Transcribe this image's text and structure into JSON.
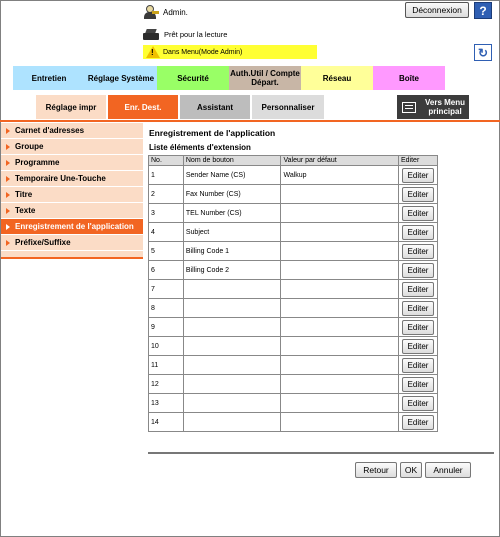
{
  "header": {
    "user_label": "Admin.",
    "logout_label": "Déconnexion",
    "help_label": "?",
    "status_text": "Prêt pour la lecture",
    "mode_text": "Dans Menu(Mode Admin)"
  },
  "main_tabs": [
    {
      "label": "Entretien",
      "color": "#aee3ff"
    },
    {
      "label": "Réglage Système",
      "color": "#aee3ff"
    },
    {
      "label": "Sécurité",
      "color": "#99ff66"
    },
    {
      "label": "Auth.Util / Compte Départ.",
      "color": "#c8b6a6"
    },
    {
      "label": "Réseau",
      "color": "#ffff99"
    },
    {
      "label": "Boîte",
      "color": "#ff99ff"
    }
  ],
  "sub_tabs": [
    {
      "label": "Réglage impr",
      "color": "#fbdcc6"
    },
    {
      "label": "Enr. Dest.",
      "color": "#f26522"
    },
    {
      "label": "Assistant",
      "color": "#bdbdbd"
    },
    {
      "label": "Personnaliser",
      "color": "#dcdcdc"
    }
  ],
  "vers_menu_label": "Vers Menu principal",
  "sidebar": {
    "items": [
      {
        "label": "Carnet d'adresses"
      },
      {
        "label": "Groupe"
      },
      {
        "label": "Programme"
      },
      {
        "label": "Temporaire Une-Touche"
      },
      {
        "label": "Titre"
      },
      {
        "label": "Texte"
      },
      {
        "label": "Enregistrement de l'application"
      },
      {
        "label": "Préfixe/Suffixe"
      }
    ]
  },
  "content": {
    "title": "Enregistrement de l'application",
    "subtitle": "Liste éléments d'extension",
    "columns": [
      "No.",
      "Nom de bouton",
      "Valeur par défaut",
      "Editer"
    ],
    "rows": [
      {
        "no": "1",
        "name": "Sender Name (CS)",
        "default": "Walkup"
      },
      {
        "no": "2",
        "name": "Fax Number (CS)",
        "default": ""
      },
      {
        "no": "3",
        "name": "TEL Number (CS)",
        "default": ""
      },
      {
        "no": "4",
        "name": "Subject",
        "default": ""
      },
      {
        "no": "5",
        "name": "Billing Code 1",
        "default": ""
      },
      {
        "no": "6",
        "name": "Billing Code 2",
        "default": ""
      },
      {
        "no": "7",
        "name": "",
        "default": ""
      },
      {
        "no": "8",
        "name": "",
        "default": ""
      },
      {
        "no": "9",
        "name": "",
        "default": ""
      },
      {
        "no": "10",
        "name": "",
        "default": ""
      },
      {
        "no": "11",
        "name": "",
        "default": ""
      },
      {
        "no": "12",
        "name": "",
        "default": ""
      },
      {
        "no": "13",
        "name": "",
        "default": ""
      },
      {
        "no": "14",
        "name": "",
        "default": ""
      }
    ],
    "edit_label": "Editer"
  },
  "footer": {
    "back_label": "Retour",
    "ok_label": "OK",
    "cancel_label": "Annuler"
  },
  "colors": {
    "accent": "#f26522",
    "sidebar_bg": "#fbdcc6",
    "mode_bar": "#ffff33",
    "help_blue": "#2f5fb3"
  }
}
